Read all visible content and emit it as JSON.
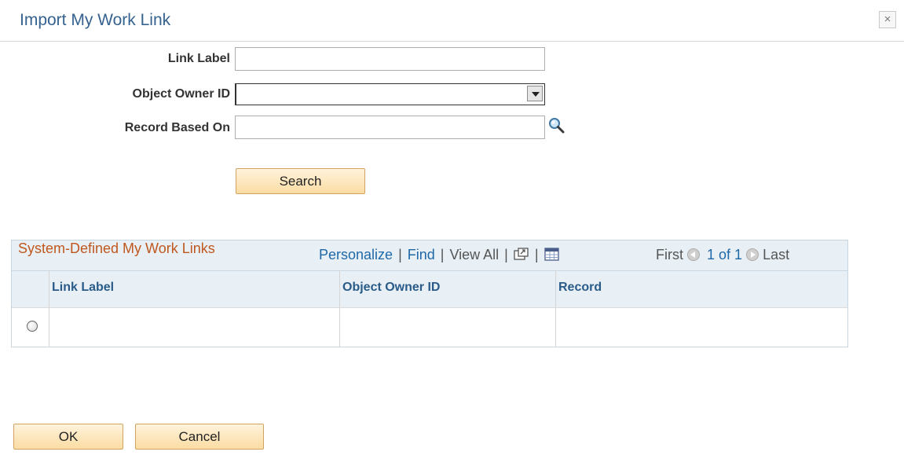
{
  "dialog": {
    "title": "Import My Work Link",
    "close_symbol": "×"
  },
  "form": {
    "link_label": {
      "label": "Link Label",
      "value": ""
    },
    "object_owner_id": {
      "label": "Object Owner ID",
      "value": ""
    },
    "record_based_on": {
      "label": "Record Based On",
      "value": ""
    },
    "lookup_icon": "magnifier-icon",
    "search_button": "Search"
  },
  "grid": {
    "title": "System-Defined My Work Links",
    "nav": {
      "personalize": "Personalize",
      "find": "Find",
      "view_all": "View All",
      "sep": "|",
      "first": "First",
      "range": "1 of 1",
      "last": "Last"
    },
    "columns": [
      "Link Label",
      "Object Owner ID",
      "Record"
    ],
    "rows": [
      {
        "link_label": "",
        "object_owner_id": "",
        "record": ""
      }
    ]
  },
  "footer": {
    "ok_button": "OK",
    "cancel_button": "Cancel"
  },
  "colors": {
    "title_blue": "#36628f",
    "grid_title_orange": "#c0571f",
    "link_blue": "#1f68a8",
    "button_gradient_bottom": "#fbdca3"
  }
}
